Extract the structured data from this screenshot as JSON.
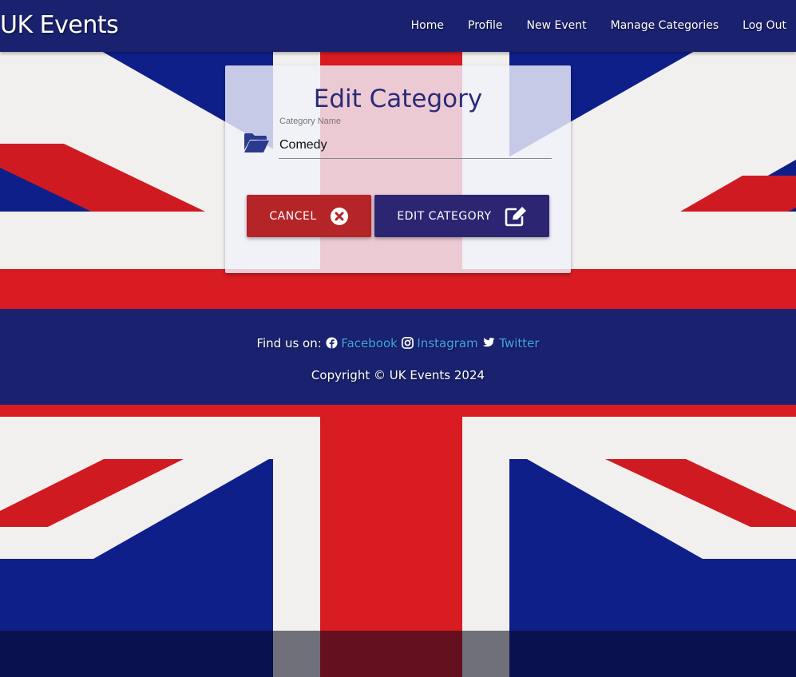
{
  "nav": {
    "brand": "UK Events",
    "items": [
      "Home",
      "Profile",
      "New Event",
      "Manage Categories",
      "Log Out"
    ]
  },
  "form": {
    "title": "Edit Category",
    "field_label": "Category Name",
    "field_value": "Comedy",
    "field_icon": "folder-open-icon",
    "cancel_label": "CANCEL",
    "cancel_icon": "times-circle-icon",
    "submit_label": "EDIT CATEGORY",
    "submit_icon": "edit-icon"
  },
  "footer": {
    "find_label": "Find us on:",
    "links": [
      "Facebook",
      "Instagram",
      "Twitter"
    ],
    "copyright": "Copyright © UK Events 2024"
  },
  "colors": {
    "nav_bg": "#1a2270",
    "cancel_bg": "#b52427",
    "submit_bg": "#2b2572",
    "link": "#42a5f5",
    "title": "#2b2a78"
  }
}
